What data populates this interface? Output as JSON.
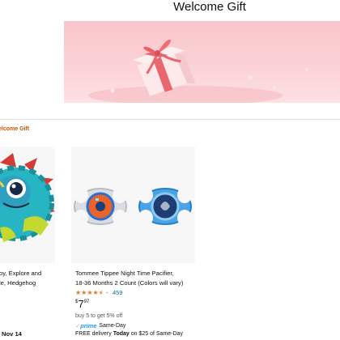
{
  "header": {
    "title": "Welcome Gift"
  },
  "breadcrumb": {
    "label": "elcome Gift"
  },
  "colors": {
    "link_orange": "#c45500",
    "link_teal": "#007185",
    "star": "#de7921",
    "prime_blue": "#1399ff",
    "banner_pink": "#f8c6ca"
  },
  "products": [
    {
      "title_lines": [
        "oy, Explore and",
        "le, Hedgehog"
      ],
      "delivery_date": "Nov 14"
    },
    {
      "title_lines": [
        "Tommee Tippee Night Time Pacifier,",
        "18-36 Months 2 Count (Colors will vary)"
      ],
      "rating": 4.5,
      "rating_count": "459",
      "price_symbol": "$",
      "price_whole": "7",
      "price_fraction": "97",
      "promo": "buy 5 to get 5% off",
      "prime_label": "prime",
      "prime_suffix": "Same-Day",
      "delivery_prefix": "FREE delivery ",
      "delivery_day": "Today",
      "delivery_suffix": " on $25 of Same-Day"
    }
  ]
}
